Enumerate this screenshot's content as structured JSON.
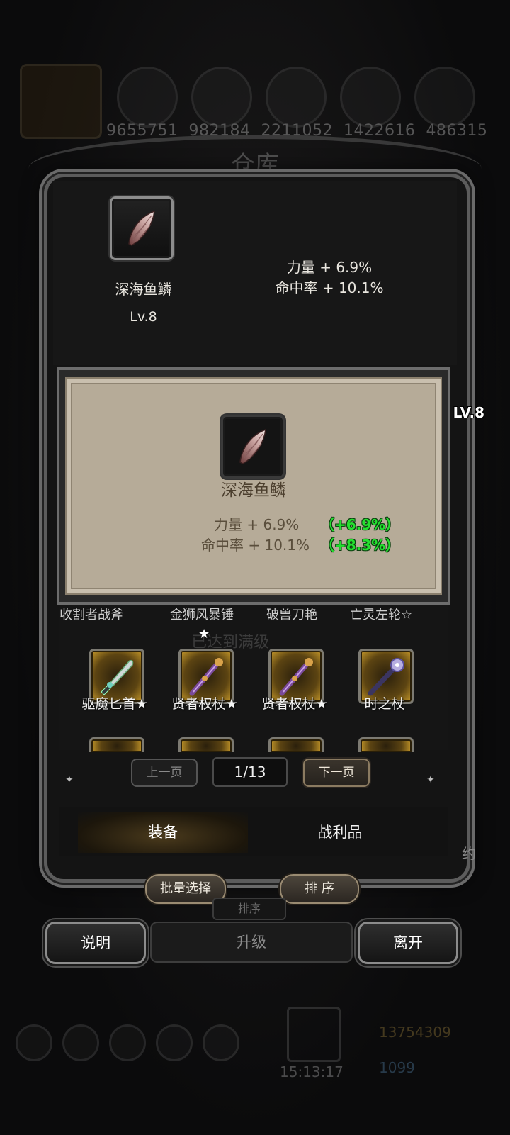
{
  "background_hud": {
    "resources": [
      "9655751",
      "982184",
      "2211052",
      "1422616",
      "486315"
    ],
    "title": "仓库",
    "gold": "13754309",
    "gems": "1099",
    "clock": "15:13:17"
  },
  "top_item": {
    "name": "深海鱼鳞",
    "level": "Lv.8",
    "stats": [
      "力量 + 6.9%",
      "命中率 + 10.1%"
    ]
  },
  "tooltip": {
    "level": "LV.8",
    "name": "深海鱼鳞",
    "stats": [
      {
        "text": "力量 + 6.9%",
        "bonus": "（+6.9%）"
      },
      {
        "text": "命中率 + 10.1%",
        "bonus": "（+8.3%）"
      }
    ]
  },
  "inventory": {
    "cut_row_labels": [
      "收割者战斧",
      "金狮风暴锤",
      "破兽刀艳",
      "亡灵左轮☆"
    ],
    "cut_row_star": "★",
    "faded_text": "已达到满级",
    "items": [
      {
        "label": "驱魔匕首★",
        "icon": "dagger-icon"
      },
      {
        "label": "贤者权杖★",
        "icon": "scepter-icon"
      },
      {
        "label": "贤者权杖★",
        "icon": "scepter-icon"
      },
      {
        "label": "时之杖",
        "icon": "staff-icon"
      }
    ]
  },
  "pagination": {
    "prev": "上一页",
    "indicator": "1/13",
    "next": "下一页"
  },
  "tabs": {
    "equipment": "装备",
    "loot": "战利品",
    "side_text": "约"
  },
  "actions": {
    "batch_select": "批量选择",
    "sort": "排 序",
    "sort_ghost": "排序"
  },
  "bottom": {
    "explain": "说明",
    "upgrade": "升级",
    "leave": "离开"
  },
  "colors": {
    "bonus_green": "#24e02f",
    "parchment": "#b6ab98",
    "frame_gray": "#5c5c5c"
  }
}
